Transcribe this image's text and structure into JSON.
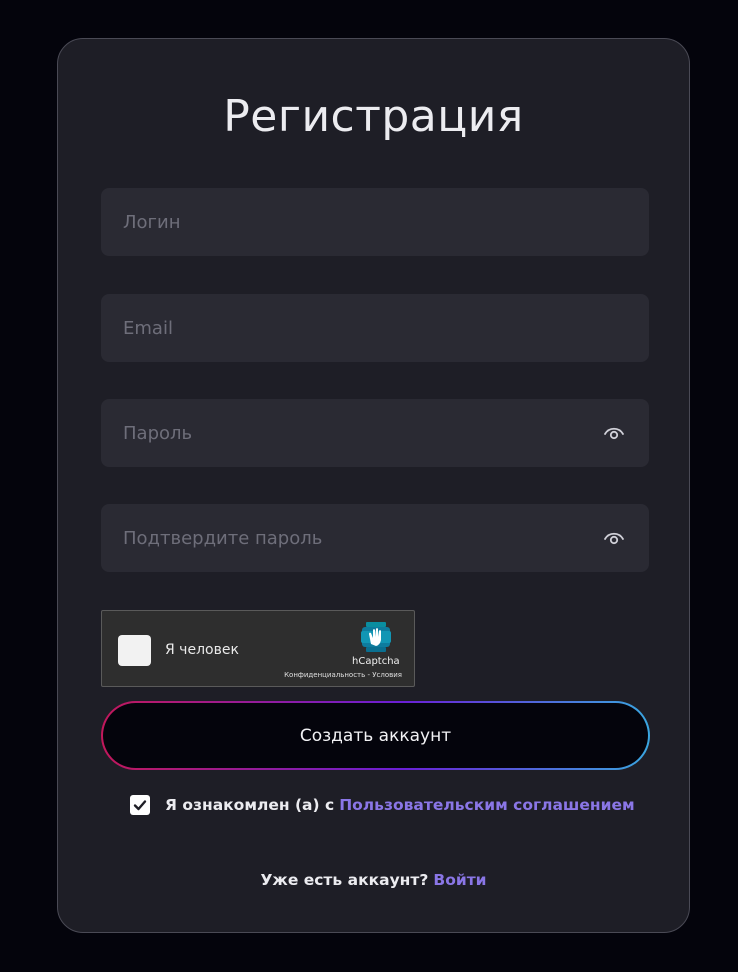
{
  "form": {
    "title": "Регистрация",
    "fields": [
      {
        "placeholder": "Логин",
        "value": ""
      },
      {
        "placeholder": "Email",
        "value": ""
      },
      {
        "placeholder": "Пароль",
        "value": "",
        "icon": "eye-icon"
      },
      {
        "placeholder": "Подтвердите пароль",
        "value": "",
        "icon": "eye-icon"
      }
    ]
  },
  "captcha": {
    "label": "Я человек",
    "brand": "hCaptcha",
    "links": "Конфиденциальность - Условия",
    "checked": false,
    "icon": "hcaptcha-logo-icon"
  },
  "actions": {
    "create_label": "Создать аккаунт"
  },
  "agreement": {
    "checked": true,
    "text": "Я ознакомлен (а) с",
    "link_text": "Пользовательским соглашением"
  },
  "login": {
    "question": "Уже есть аккаунт?",
    "link_text": "Войти"
  },
  "colors": {
    "background": "#04040c",
    "card": "#1e1e26",
    "field": "#2a2a33",
    "link": "#8a76e6",
    "button_gradient": [
      "#c2185b",
      "#6a1fd6",
      "#3aa6e0"
    ]
  }
}
